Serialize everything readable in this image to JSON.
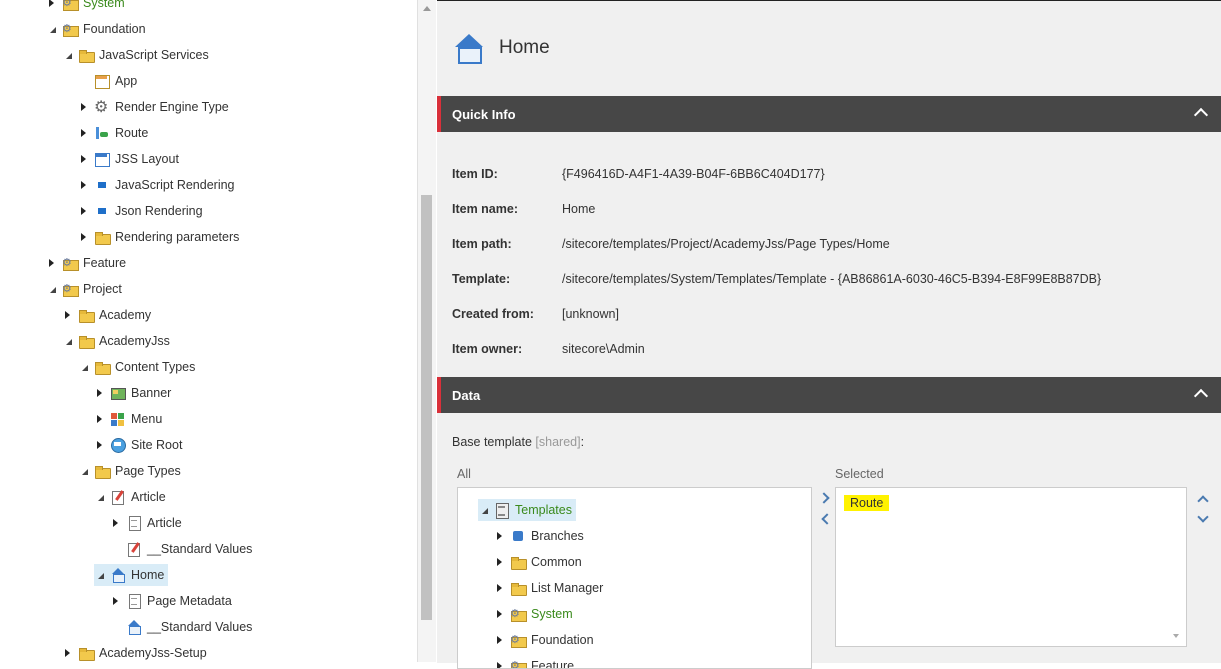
{
  "tree": {
    "items": [
      {
        "label": "System",
        "level": 0,
        "toggle": "collapsed",
        "icon": "gear-folder-icon",
        "green": true
      },
      {
        "label": "Foundation",
        "level": 0,
        "toggle": "expanded",
        "icon": "gear-folder-icon"
      },
      {
        "label": "JavaScript Services",
        "level": 1,
        "toggle": "expanded",
        "icon": "folder-icon"
      },
      {
        "label": "App",
        "level": 2,
        "toggle": "none",
        "icon": "app-icon"
      },
      {
        "label": "Render Engine Type",
        "level": 2,
        "toggle": "collapsed",
        "icon": "gear-icon"
      },
      {
        "label": "Route",
        "level": 2,
        "toggle": "collapsed",
        "icon": "route-icon"
      },
      {
        "label": "JSS Layout",
        "level": 2,
        "toggle": "collapsed",
        "icon": "layout-icon"
      },
      {
        "label": "JavaScript Rendering",
        "level": 2,
        "toggle": "collapsed",
        "icon": "rendering-icon"
      },
      {
        "label": "Json Rendering",
        "level": 2,
        "toggle": "collapsed",
        "icon": "rendering-icon"
      },
      {
        "label": "Rendering parameters",
        "level": 2,
        "toggle": "collapsed",
        "icon": "folder-icon"
      },
      {
        "label": "Feature",
        "level": 0,
        "toggle": "collapsed",
        "icon": "gear-folder-icon"
      },
      {
        "label": "Project",
        "level": 0,
        "toggle": "expanded",
        "icon": "gear-folder-icon"
      },
      {
        "label": "Academy",
        "level": 1,
        "toggle": "collapsed",
        "icon": "folder-icon"
      },
      {
        "label": "AcademyJss",
        "level": 1,
        "toggle": "expanded",
        "icon": "folder-icon"
      },
      {
        "label": "Content Types",
        "level": 2,
        "toggle": "expanded",
        "icon": "folder-icon"
      },
      {
        "label": "Banner",
        "level": 3,
        "toggle": "collapsed",
        "icon": "banner-icon"
      },
      {
        "label": "Menu",
        "level": 3,
        "toggle": "collapsed",
        "icon": "menu-icon"
      },
      {
        "label": "Site Root",
        "level": 3,
        "toggle": "collapsed",
        "icon": "site-root-icon"
      },
      {
        "label": "Page Types",
        "level": 2,
        "toggle": "expanded",
        "icon": "folder-icon"
      },
      {
        "label": "Article",
        "level": 3,
        "toggle": "expanded",
        "icon": "article-template-icon"
      },
      {
        "label": "Article",
        "level": 4,
        "toggle": "collapsed",
        "icon": "page-icon"
      },
      {
        "label": "__Standard Values",
        "level": 4,
        "toggle": "none",
        "icon": "article-template-icon"
      },
      {
        "label": "Home",
        "level": 3,
        "toggle": "expanded",
        "icon": "home-icon",
        "selected": true
      },
      {
        "label": "Page Metadata",
        "level": 4,
        "toggle": "collapsed",
        "icon": "page-icon"
      },
      {
        "label": "__Standard Values",
        "level": 4,
        "toggle": "none",
        "icon": "home-icon"
      },
      {
        "label": "AcademyJss-Setup",
        "level": 1,
        "toggle": "collapsed",
        "icon": "folder-icon"
      }
    ]
  },
  "header": {
    "title": "Home",
    "icon": "home-icon"
  },
  "quick_info": {
    "title": "Quick Info",
    "rows": [
      {
        "label": "Item ID:",
        "value": "{F496416D-A4F1-4A39-B04F-6BB6C404D177}"
      },
      {
        "label": "Item name:",
        "value": "Home"
      },
      {
        "label": "Item path:",
        "value": "/sitecore/templates/Project/AcademyJss/Page Types/Home"
      },
      {
        "label": "Template:",
        "value": "/sitecore/templates/System/Templates/Template - {AB86861A-6030-46C5-B394-E8F99E8B87DB}"
      },
      {
        "label": "Created from:",
        "value": "[unknown]"
      },
      {
        "label": "Item owner:",
        "value": "sitecore\\Admin"
      }
    ]
  },
  "data_section": {
    "title": "Data",
    "base_template_label": "Base template",
    "shared_tag": "[shared]",
    "label_suffix": ":",
    "all_label": "All",
    "selected_label": "Selected",
    "all_tree": [
      {
        "label": "Templates",
        "level": 0,
        "toggle": "expanded",
        "icon": "templates-icon",
        "selected": true,
        "green": true
      },
      {
        "label": "Branches",
        "level": 1,
        "toggle": "collapsed",
        "icon": "puzzle-icon"
      },
      {
        "label": "Common",
        "level": 1,
        "toggle": "collapsed",
        "icon": "folder-icon"
      },
      {
        "label": "List Manager",
        "level": 1,
        "toggle": "collapsed",
        "icon": "folder-icon"
      },
      {
        "label": "System",
        "level": 1,
        "toggle": "collapsed",
        "icon": "gear-folder-icon",
        "green": true
      },
      {
        "label": "Foundation",
        "level": 1,
        "toggle": "collapsed",
        "icon": "gear-folder-icon"
      },
      {
        "label": "Feature",
        "level": 1,
        "toggle": "collapsed",
        "icon": "gear-folder-icon"
      }
    ],
    "selected_items": [
      "Route"
    ]
  },
  "colors": {
    "section_bar": "#474747",
    "section_accent": "#d9303a",
    "selected_highlight": "#fff200",
    "tree_selected": "#d9ecf7"
  }
}
